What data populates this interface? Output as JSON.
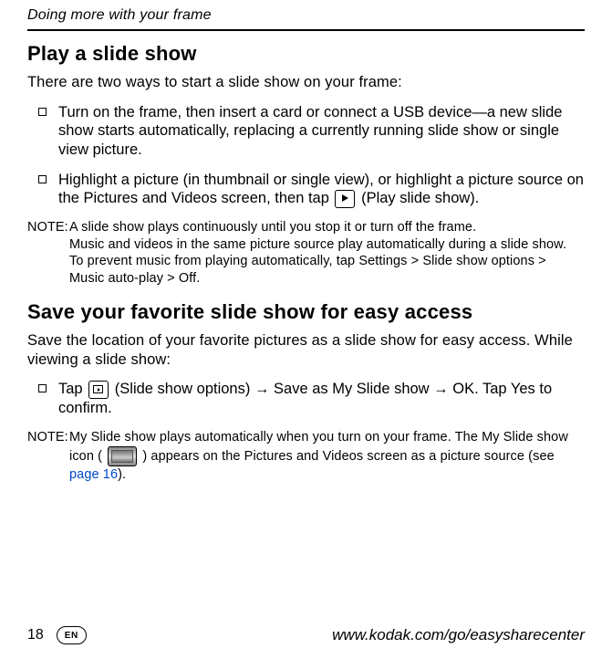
{
  "running_head": "Doing more with your frame",
  "section1": {
    "title": "Play a slide show",
    "intro": "There are two ways to start a slide show on your frame:",
    "bullets": [
      "Turn on the frame, then insert a card or connect a USB device—a new slide show starts automatically, replacing a currently running slide show or single view picture.",
      {
        "pre": "Highlight a picture (in thumbnail or single view), or highlight a picture source on the Pictures and Videos screen, then tap ",
        "post": " (Play slide show)."
      }
    ],
    "note": {
      "label": "NOTE:",
      "lines": [
        "A slide show plays continuously until you stop it or turn off the frame.",
        "Music and videos in the same picture source play automatically during a slide show.",
        "To prevent music from playing automatically, tap Settings > Slide show options > Music auto-play > Off."
      ]
    }
  },
  "section2": {
    "title": "Save your favorite slide show for easy access",
    "intro": "Save the location of your favorite pictures as a slide show for easy access. While viewing a slide show:",
    "bullet": {
      "pre": "Tap ",
      "post": " (Slide show options) → Save as My Slide show → OK. Tap Yes to confirm."
    },
    "note": {
      "label": "NOTE:",
      "pre": "My Slide show plays automatically when you turn on your frame. The My Slide show icon (",
      "mid": ") appears on the Pictures and Videos screen as a picture source (see ",
      "link": "page 16",
      "post": ")."
    }
  },
  "footer": {
    "page": "18",
    "badge": "EN",
    "url": "www.kodak.com/go/easysharecenter"
  }
}
